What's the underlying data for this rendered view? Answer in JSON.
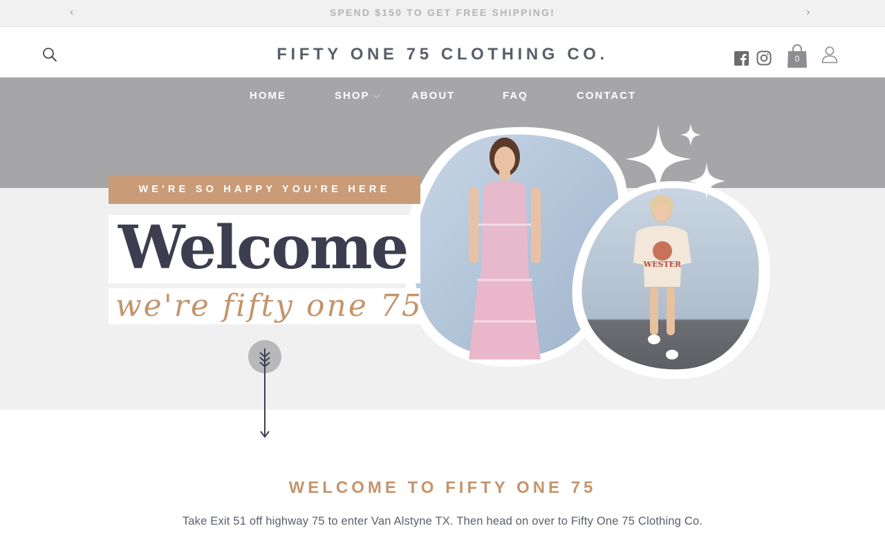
{
  "announcement": {
    "message": "SPEND $150 TO GET FREE SHIPPING!",
    "prev_icon": "chevron-left-icon",
    "next_icon": "chevron-right-icon"
  },
  "header": {
    "brand": "FIFTY ONE 75 CLOTHING CO.",
    "search_icon": "search-icon",
    "facebook_icon": "facebook-icon",
    "instagram_icon": "instagram-icon",
    "cart_icon": "shopping-bag-icon",
    "cart_count": "0",
    "account_icon": "user-icon"
  },
  "nav": {
    "items": [
      {
        "label": "HOME"
      },
      {
        "label": "SHOP",
        "has_dropdown": true
      },
      {
        "label": "ABOUT"
      },
      {
        "label": "FAQ"
      },
      {
        "label": "CONTACT"
      }
    ]
  },
  "hero": {
    "tagline": "WE'RE SO HAPPY YOU'RE HERE",
    "headline": "Welcome",
    "script": "we're fifty one 75",
    "scroll_icon": "arrow-down-icon",
    "sparkle_icon": "sparkle-icon"
  },
  "intro": {
    "title": "WELCOME TO FIFTY ONE 75",
    "text": "Take Exit 51 off highway 75 to enter Van Alstyne TX. Then head on over to Fifty One 75 Clothing Co."
  },
  "colors": {
    "announcement_bg": "#f1f1f1",
    "hero_top": "#a6a6a8",
    "hero_bottom": "#f0f0f0",
    "accent_tan": "#c99b77",
    "dark_navy": "#3c3e50",
    "brand_gray": "#5a5e6a"
  }
}
